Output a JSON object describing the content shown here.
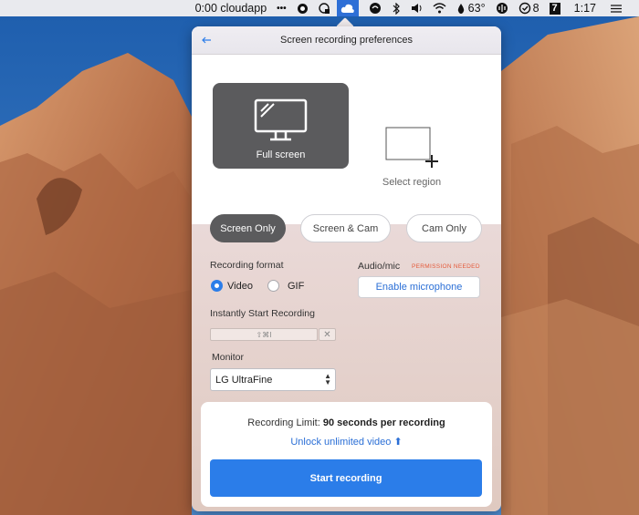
{
  "menubar": {
    "recording_timer": "0:00 cloudapp",
    "more_label": "•••",
    "weather": "63°",
    "badge_count": "8",
    "seven_badge": "7",
    "time": "1:17"
  },
  "panel": {
    "title": "Screen recording preferences",
    "modes": {
      "full_screen_label": "Full screen",
      "select_region_label": "Select region"
    },
    "segments": [
      "Screen Only",
      "Screen & Cam",
      "Cam Only"
    ],
    "recording_format_label": "Recording format",
    "formats": {
      "video": "Video",
      "gif": "GIF"
    },
    "audio_label": "Audio/mic",
    "permission_label": "PERMISSION NEEDED",
    "enable_mic_label": "Enable microphone",
    "instant_start_label": "Instantly Start Recording",
    "shortcut_value": "⇧⌘I",
    "shortcut_clear": "✕",
    "monitor_label": "Monitor",
    "monitor_value": "LG UltraFine",
    "limit_prefix": "Recording Limit:",
    "limit_value": "90 seconds per recording",
    "unlock_label": "Unlock unlimited video ⬆",
    "start_label": "Start recording"
  },
  "colors": {
    "accent": "#2b7de9",
    "dark_button": "#5b5b5d",
    "permission_red": "#e45a3a",
    "sky": "#2f6fb8",
    "rock": "#c47a52"
  },
  "icons": [
    "back-arrow-icon",
    "monitor-icon",
    "region-plus-icon",
    "chevron-updown-icon",
    "cloudapp-icon",
    "wifi-icon",
    "volume-icon",
    "clock-check-icon"
  ]
}
